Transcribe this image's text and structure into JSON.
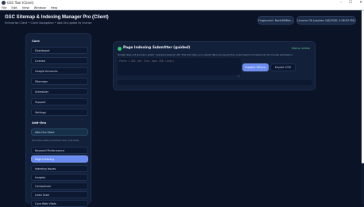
{
  "window": {
    "title": "GSC Tool (Client)",
    "controls": {
      "minimize": "–",
      "maximize": "☐",
      "close": "✕"
    }
  },
  "menu": [
    "File",
    "Edit",
    "View",
    "Window",
    "Help"
  ],
  "header": {
    "title": "GSC Sitemap & Indexing Manager Pro (Client)",
    "subtitle": "Enterprise Client • Client Navigation • Add-Ons gated by license",
    "fingerprint": "Fingerprint: 6acfc638bb...",
    "license": "License OK (expires 1/6/2026, 2:06:02 PM)"
  },
  "sidebar": {
    "core_label": "Core",
    "core_items": [
      "Dashboard",
      "License",
      "Google Accounts",
      "Sitemaps",
      "Scheduler",
      "Support",
      "Settings"
    ],
    "addons_label": "Add-Ons",
    "add_ons_button": "Add-Ons Store",
    "addons_hint": "Purchase tabs (unlocked now unlocked)",
    "addon_items": [
      "Keyword Performance",
      "Page Indexing",
      "Indexing Issues",
      "Insights",
      "Comparison",
      "Links Scan",
      "Core Web Vitals"
    ],
    "active_item": "Page Indexing"
  },
  "card": {
    "title": "Page Indexing Submitter (guided)",
    "status": "Status: active",
    "description": "Google does not provide a public \"request indexing\" API. This tool helps you inspect URLs and opens the correct Search Console links for manual submission.",
    "url_placeholder": "Paste 1 URL per line (max 200 lines)",
    "inspect_button": "Inspect URLs ▸",
    "export_button": "Export CSV",
    "progress_fraction": 0.0
  },
  "icons": {
    "status_dot": "green-dot-icon",
    "resize": "checkmark-icon",
    "check_glyph": "✓"
  },
  "colors": {
    "background": "#0b1326",
    "panel": "#13203a",
    "accent": "#6a8cf0",
    "success": "#2ecc71"
  }
}
